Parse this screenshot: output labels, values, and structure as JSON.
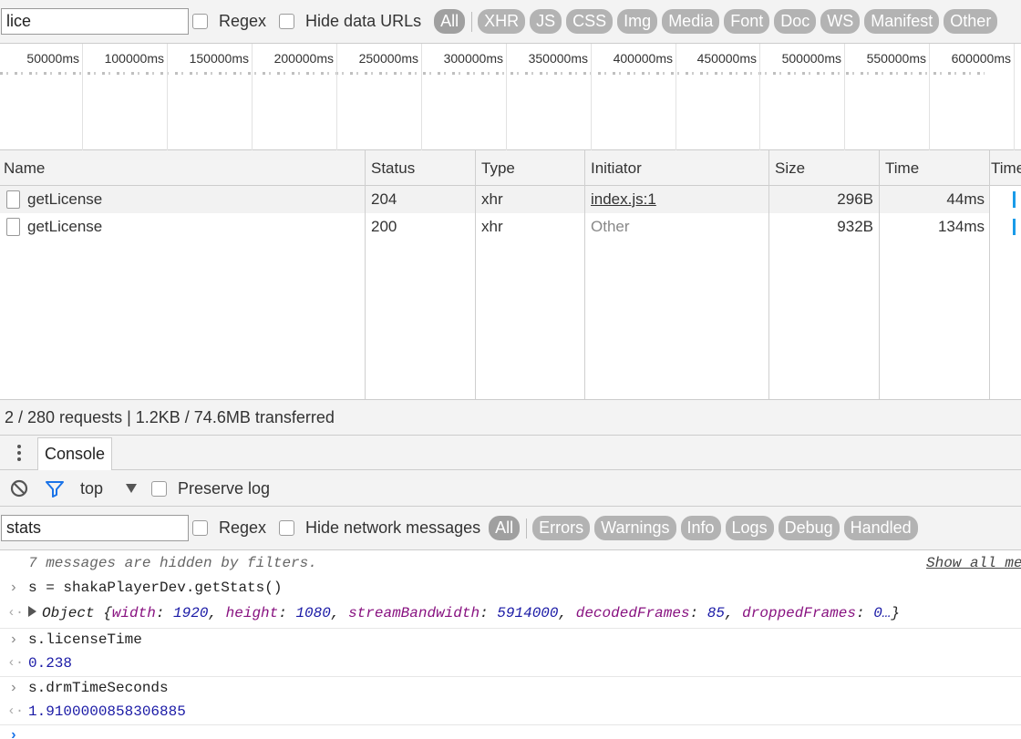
{
  "network_filter": {
    "query": "lice",
    "regex_label": "Regex",
    "hide_data_urls_label": "Hide data URLs",
    "type_filters": [
      "All",
      "XHR",
      "JS",
      "CSS",
      "Img",
      "Media",
      "Font",
      "Doc",
      "WS",
      "Manifest",
      "Other"
    ]
  },
  "timeline": {
    "ticks": [
      "50000ms",
      "100000ms",
      "150000ms",
      "200000ms",
      "250000ms",
      "300000ms",
      "350000ms",
      "400000ms",
      "450000ms",
      "500000ms",
      "550000ms",
      "600000ms"
    ]
  },
  "table": {
    "headers": {
      "name": "Name",
      "status": "Status",
      "type": "Type",
      "initiator": "Initiator",
      "size": "Size",
      "time": "Time",
      "waterfall": "Time"
    },
    "rows": [
      {
        "name": "getLicense",
        "status": "204",
        "type": "xhr",
        "initiator": "index.js:1",
        "size": "296B",
        "time": "44ms"
      },
      {
        "name": "getLicense",
        "status": "200",
        "type": "xhr",
        "initiator": "Other",
        "size": "932B",
        "time": "134ms"
      }
    ]
  },
  "status_bar": {
    "text": "2 / 280 requests | 1.2KB / 74.6MB transferred"
  },
  "drawer": {
    "tab_console": "Console"
  },
  "console_toolbar": {
    "context": "top",
    "preserve_log_label": "Preserve log"
  },
  "console_filter": {
    "query": "stats",
    "regex_label": "Regex",
    "hide_network_label": "Hide network messages",
    "levels": [
      "All",
      "Errors",
      "Warnings",
      "Info",
      "Logs",
      "Debug",
      "Handled"
    ]
  },
  "console": {
    "hidden_notice": "7 messages are hidden by filters.",
    "show_all_link": "Show all me",
    "cmd1": "s = shakaPlayerDev.getStats()",
    "obj_label": "Object",
    "obj_fields": [
      {
        "key": "width",
        "value": "1920"
      },
      {
        "key": "height",
        "value": "1080"
      },
      {
        "key": "streamBandwidth",
        "value": "5914000"
      },
      {
        "key": "decodedFrames",
        "value": "85"
      },
      {
        "key": "droppedFrames",
        "value": "0…"
      }
    ],
    "cmd2": "s.licenseTime",
    "res2": "0.238",
    "cmd3": "s.drmTimeSeconds",
    "res3": "1.9100000858306885"
  },
  "colors": {
    "waterfall": "#1a9be8",
    "number": "#1a1aa6",
    "property": "#881280",
    "filter_icon": "#1a73e8"
  }
}
